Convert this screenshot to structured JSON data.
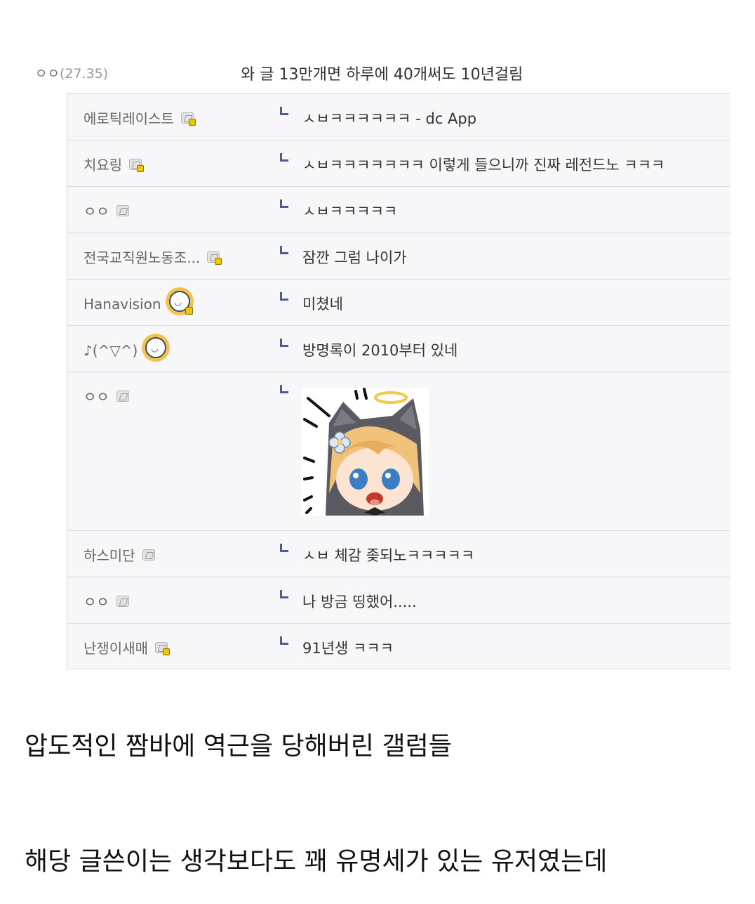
{
  "top_comment": {
    "nickname": "ㅇㅇ",
    "ip": "(27.35)",
    "text": "와 글 13만개면 하루에 40개써도 10년걸림"
  },
  "replies": [
    {
      "nickname": "에로틱레이스트",
      "icon": "fixed-gallog-icon",
      "text": "ㅅㅂㅋㅋㅋㅋㅋㅋ - dc App"
    },
    {
      "nickname": "치요링",
      "icon": "fixed-gallog-icon",
      "text": "ㅅㅂㅋㅋㅋㅋㅋㅋㅋ 이렇게 들으니까 진짜 레전드노 ㅋㅋㅋ"
    },
    {
      "nickname": "ㅇㅇ",
      "icon": "gallog-icon",
      "text": "ㅅㅂㅋㅋㅋㅋㅋ"
    },
    {
      "nickname": "전국교직원노동조...",
      "icon": "fixed-gallog-icon",
      "text": "잠깐 그럼 나이가"
    },
    {
      "nickname": "Hanavision",
      "icon": "avatar-icon",
      "text": "미쳤네"
    },
    {
      "nickname": "♪(^▽^)",
      "icon": "avatar-icon",
      "text": "방명록이 2010부터 있네"
    },
    {
      "nickname": "ㅇㅇ",
      "icon": "gallog-icon",
      "text": "",
      "image": "dccon-sticker-image"
    },
    {
      "nickname": "하스미단",
      "icon": "gallog-icon",
      "text": "ㅅㅂ 체감 좆되노ㅋㅋㅋㅋㅋ"
    },
    {
      "nickname": "ㅇㅇ",
      "icon": "gallog-icon",
      "text": "나 방금 띵했어....."
    },
    {
      "nickname": "난쟁이새매",
      "icon": "fixed-gallog-icon",
      "text": "91년생 ㅋㅋㅋ"
    }
  ],
  "body_text": {
    "line1": "압도적인 짬바에 역근을 당해버린 갤럼들",
    "line2": "해당 글쓴이는 생각보다도 꽤 유명세가 있는 유저였는데"
  }
}
